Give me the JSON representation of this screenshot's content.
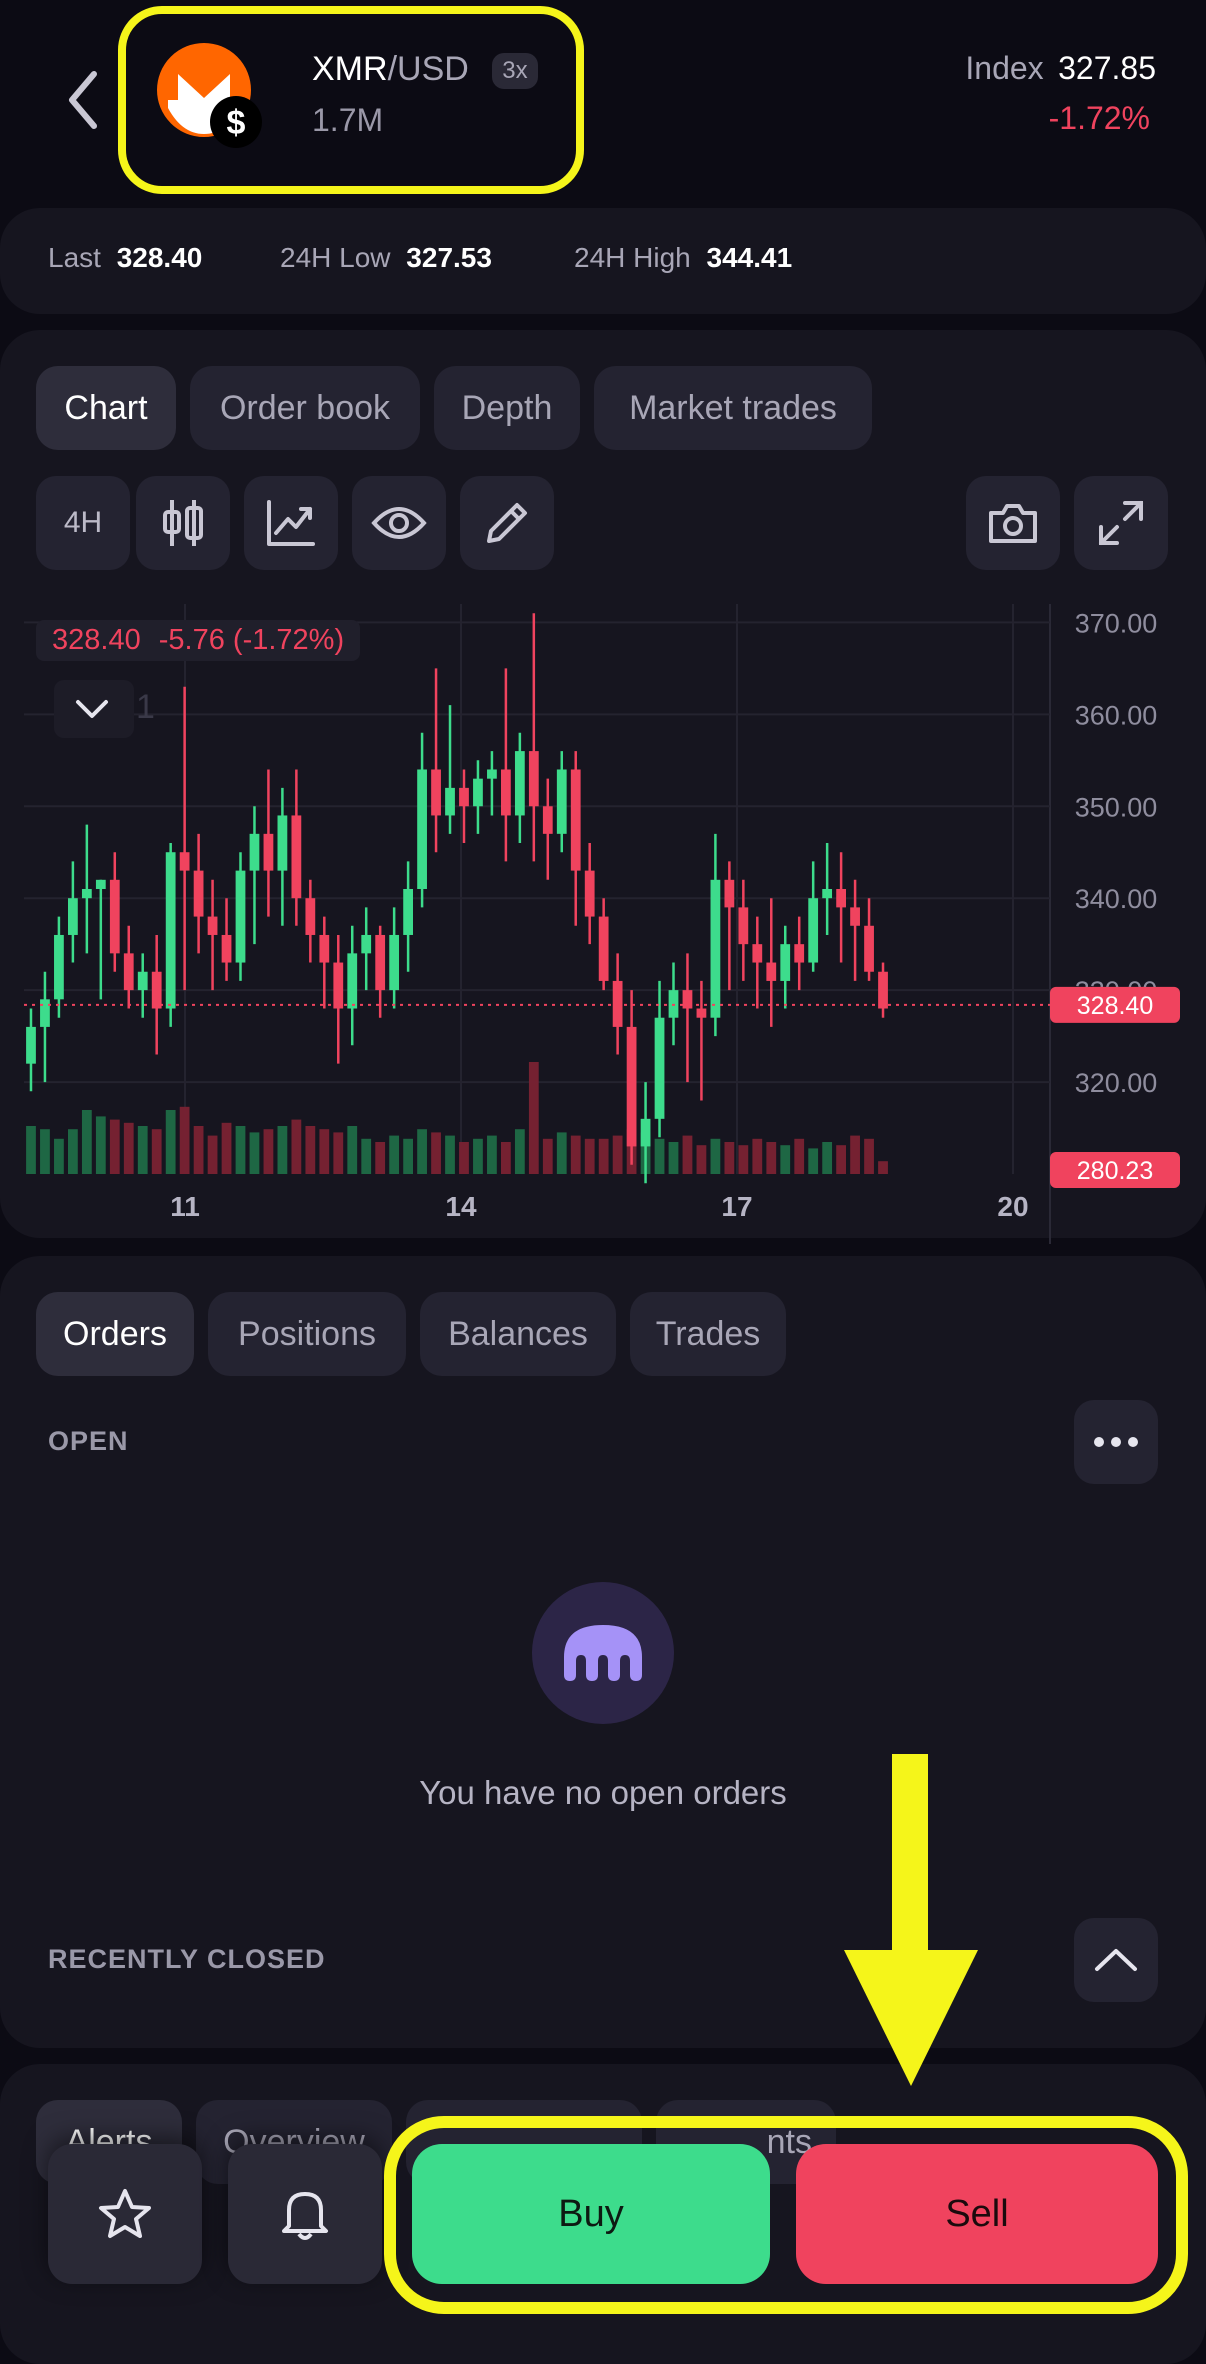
{
  "header": {
    "back_icon": "chevron-left-icon",
    "coin_icon": "monero-icon",
    "base": "XMR",
    "quote": "/USD",
    "leverage": "3x",
    "volume": "1.7M",
    "index_label": "Index",
    "index_value": "327.85",
    "change": "-1.72%"
  },
  "stats": {
    "last_label": "Last",
    "last_value": "328.40",
    "low_label": "24H Low",
    "low_value": "327.53",
    "high_label": "24H High",
    "high_value": "344.41"
  },
  "chart_tabs": [
    "Chart",
    "Order book",
    "Depth",
    "Market trades"
  ],
  "toolbar": {
    "interval": "4H",
    "icons": [
      "candles-icon",
      "indicators-icon",
      "eye-icon",
      "pencil-icon",
      "camera-icon",
      "expand-icon"
    ]
  },
  "legend": {
    "price": "328.40",
    "change": "-5.76 (-1.72%)",
    "series_count": "1"
  },
  "colors": {
    "up": "#3ddc8c",
    "down": "#f0435e",
    "accent": "#f5f51a",
    "buy": "#3ddc8c",
    "sell": "#f0435e"
  },
  "chart_data": {
    "type": "candlestick",
    "x_ticks": [
      "11",
      "14",
      "17",
      "20"
    ],
    "y_ticks": [
      "370.00",
      "360.00",
      "350.00",
      "340.00",
      "330.00",
      "320.00"
    ],
    "ylim": [
      310,
      372
    ],
    "last_price": "328.40",
    "volume_label": "280.23",
    "candles": [
      [
        322,
        326,
        319,
        328
      ],
      [
        326,
        329,
        320,
        332
      ],
      [
        329,
        336,
        327,
        338
      ],
      [
        336,
        340,
        333,
        344
      ],
      [
        340,
        341,
        334,
        348
      ],
      [
        341,
        342,
        329,
        342
      ],
      [
        342,
        334,
        332,
        345
      ],
      [
        334,
        330,
        328,
        337
      ],
      [
        330,
        332,
        327,
        334
      ],
      [
        332,
        328,
        323,
        336
      ],
      [
        328,
        345,
        326,
        346
      ],
      [
        345,
        343,
        330,
        363
      ],
      [
        343,
        338,
        334,
        347
      ],
      [
        338,
        336,
        330,
        342
      ],
      [
        336,
        333,
        331,
        340
      ],
      [
        333,
        343,
        331,
        345
      ],
      [
        343,
        347,
        335,
        350
      ],
      [
        347,
        343,
        338,
        354
      ],
      [
        343,
        349,
        337,
        352
      ],
      [
        349,
        340,
        337,
        354
      ],
      [
        340,
        336,
        333,
        342
      ],
      [
        336,
        333,
        328,
        338
      ],
      [
        333,
        328,
        322,
        336
      ],
      [
        328,
        334,
        324,
        337
      ],
      [
        334,
        336,
        330,
        339
      ],
      [
        336,
        330,
        327,
        337
      ],
      [
        330,
        336,
        328,
        339
      ],
      [
        336,
        341,
        332,
        344
      ],
      [
        341,
        354,
        339,
        358
      ],
      [
        354,
        349,
        345,
        365
      ],
      [
        349,
        352,
        347,
        361
      ],
      [
        352,
        350,
        346,
        354
      ],
      [
        350,
        353,
        347,
        355
      ],
      [
        353,
        354,
        349,
        356
      ],
      [
        354,
        349,
        344,
        365
      ],
      [
        349,
        356,
        346,
        358
      ],
      [
        356,
        350,
        344,
        371
      ],
      [
        350,
        347,
        342,
        353
      ],
      [
        347,
        354,
        345,
        356
      ],
      [
        354,
        343,
        337,
        356
      ],
      [
        343,
        338,
        335,
        346
      ],
      [
        338,
        331,
        330,
        340
      ],
      [
        331,
        326,
        323,
        334
      ],
      [
        326,
        313,
        311,
        330
      ],
      [
        313,
        316,
        309,
        320
      ],
      [
        316,
        327,
        314,
        331
      ],
      [
        327,
        330,
        324,
        333
      ],
      [
        330,
        328,
        320,
        334
      ],
      [
        328,
        327,
        318,
        331
      ],
      [
        327,
        342,
        325,
        347
      ],
      [
        342,
        339,
        330,
        344
      ],
      [
        339,
        335,
        331,
        342
      ],
      [
        335,
        333,
        328,
        338
      ],
      [
        333,
        331,
        326,
        340
      ],
      [
        331,
        335,
        328,
        337
      ],
      [
        335,
        333,
        330,
        338
      ],
      [
        333,
        340,
        332,
        344
      ],
      [
        340,
        341,
        336,
        346
      ],
      [
        341,
        339,
        333,
        345
      ],
      [
        339,
        337,
        331,
        342
      ],
      [
        337,
        332,
        331,
        340
      ],
      [
        332,
        328,
        327,
        333
      ]
    ],
    "volumes": [
      30,
      28,
      22,
      28,
      40,
      36,
      34,
      32,
      30,
      28,
      40,
      42,
      30,
      24,
      32,
      30,
      26,
      28,
      30,
      34,
      30,
      28,
      26,
      30,
      22,
      20,
      24,
      22,
      28,
      26,
      24,
      20,
      22,
      24,
      20,
      28,
      70,
      22,
      26,
      24,
      22,
      22,
      24,
      28,
      26,
      22,
      20,
      24,
      18,
      22,
      20,
      18,
      22,
      20,
      18,
      22,
      16,
      20,
      18,
      24,
      22,
      8
    ]
  },
  "orders": {
    "tabs": [
      "Orders",
      "Positions",
      "Balances",
      "Trades"
    ],
    "open_label": "OPEN",
    "more_icon": "more-horizontal-icon",
    "empty_icon": "kraken-logo-icon",
    "empty_text": "You have no open orders",
    "recently_closed_label": "RECENTLY CLOSED",
    "collapse_icon": "chevron-up-icon"
  },
  "bottom": {
    "tabs": [
      "Alerts",
      "Overview"
    ],
    "partial_tab": "nts",
    "star_icon": "star-icon",
    "bell_icon": "bell-icon",
    "buy_label": "Buy",
    "sell_label": "Sell"
  },
  "annotation": {
    "arrow_icon": "down-arrow-icon"
  }
}
